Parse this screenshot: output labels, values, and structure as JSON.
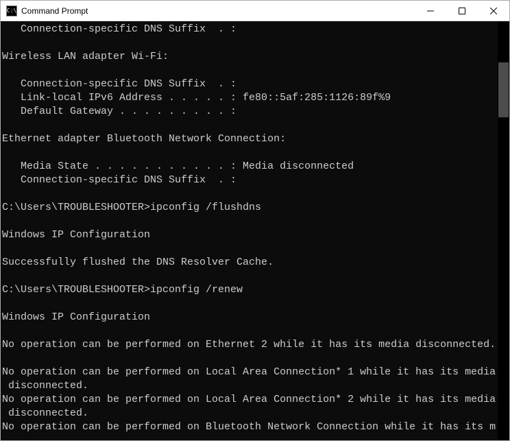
{
  "titlebar": {
    "title": "Command Prompt",
    "icon_label": "C:\\"
  },
  "terminal": {
    "lines": [
      "   Connection-specific DNS Suffix  . :",
      "",
      "Wireless LAN adapter Wi-Fi:",
      "",
      "   Connection-specific DNS Suffix  . :",
      "   Link-local IPv6 Address . . . . . : fe80::5af:285:1126:89f%9",
      "   Default Gateway . . . . . . . . . :",
      "",
      "Ethernet adapter Bluetooth Network Connection:",
      "",
      "   Media State . . . . . . . . . . . : Media disconnected",
      "   Connection-specific DNS Suffix  . :",
      "",
      "C:\\Users\\TROUBLESHOOTER>ipconfig /flushdns",
      "",
      "Windows IP Configuration",
      "",
      "Successfully flushed the DNS Resolver Cache.",
      "",
      "C:\\Users\\TROUBLESHOOTER>ipconfig /renew",
      "",
      "Windows IP Configuration",
      "",
      "No operation can be performed on Ethernet 2 while it has its media disconnected.",
      "",
      "No operation can be performed on Local Area Connection* 1 while it has its media",
      " disconnected.",
      "No operation can be performed on Local Area Connection* 2 while it has its media",
      " disconnected.",
      "No operation can be performed on Bluetooth Network Connection while it has its m"
    ]
  }
}
